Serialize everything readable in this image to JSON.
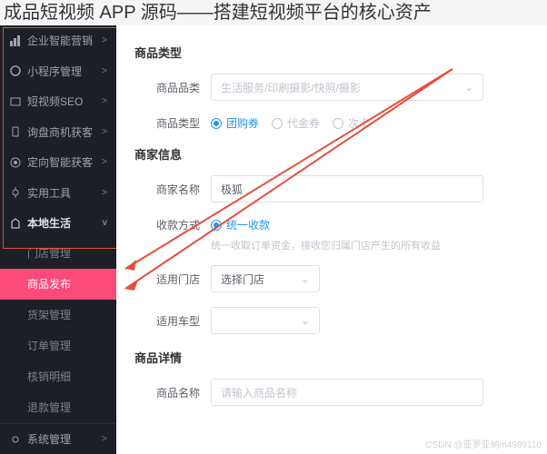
{
  "title": "成品短视频 APP 源码——搭建短视频平台的核心资产",
  "sidebar": {
    "items": [
      {
        "icon": "chart",
        "label": "企业智能营销",
        "chev": ">"
      },
      {
        "icon": "app",
        "label": "小程序管理",
        "chev": ">"
      },
      {
        "icon": "video",
        "label": "短视频SEO",
        "chev": ">"
      },
      {
        "icon": "phone",
        "label": "询盘商机获客",
        "chev": ">"
      },
      {
        "icon": "target",
        "label": "定向智能获客",
        "chev": ">"
      },
      {
        "icon": "tool",
        "label": "实用工具",
        "chev": ">"
      }
    ],
    "local": {
      "label": "本地生活",
      "chev": "v"
    },
    "subs": [
      {
        "label": "门店管理"
      },
      {
        "label": "商品发布",
        "active": true
      },
      {
        "label": "货架管理"
      },
      {
        "label": "订单管理"
      },
      {
        "label": "核销明细"
      },
      {
        "label": "退款管理"
      }
    ],
    "sys": {
      "label": "系统管理",
      "chev": ">"
    }
  },
  "form": {
    "sec1": "商品类型",
    "cat_lbl": "商品品类",
    "cat_ph": "生活服务/印刷摄影/快照/摄影",
    "type_lbl": "商品类型",
    "type_opts": [
      "团购券",
      "代金券",
      "次卡"
    ],
    "sec2": "商家信息",
    "merchant_lbl": "商家名称",
    "merchant_val": "极狐",
    "pay_lbl": "收款方式",
    "pay_opts": [
      "统一收款"
    ],
    "pay_tip": "统一收取订单资金，接收您归属门店产生的所有收益",
    "store_lbl": "适用门店",
    "store_ph": "选择门店",
    "car_lbl": "适用车型",
    "sec3": "商品详情",
    "name_lbl": "商品名称",
    "name_ph": "请输入商品名称"
  },
  "watermark": "CSDN @亚罗亚纳m4989110"
}
